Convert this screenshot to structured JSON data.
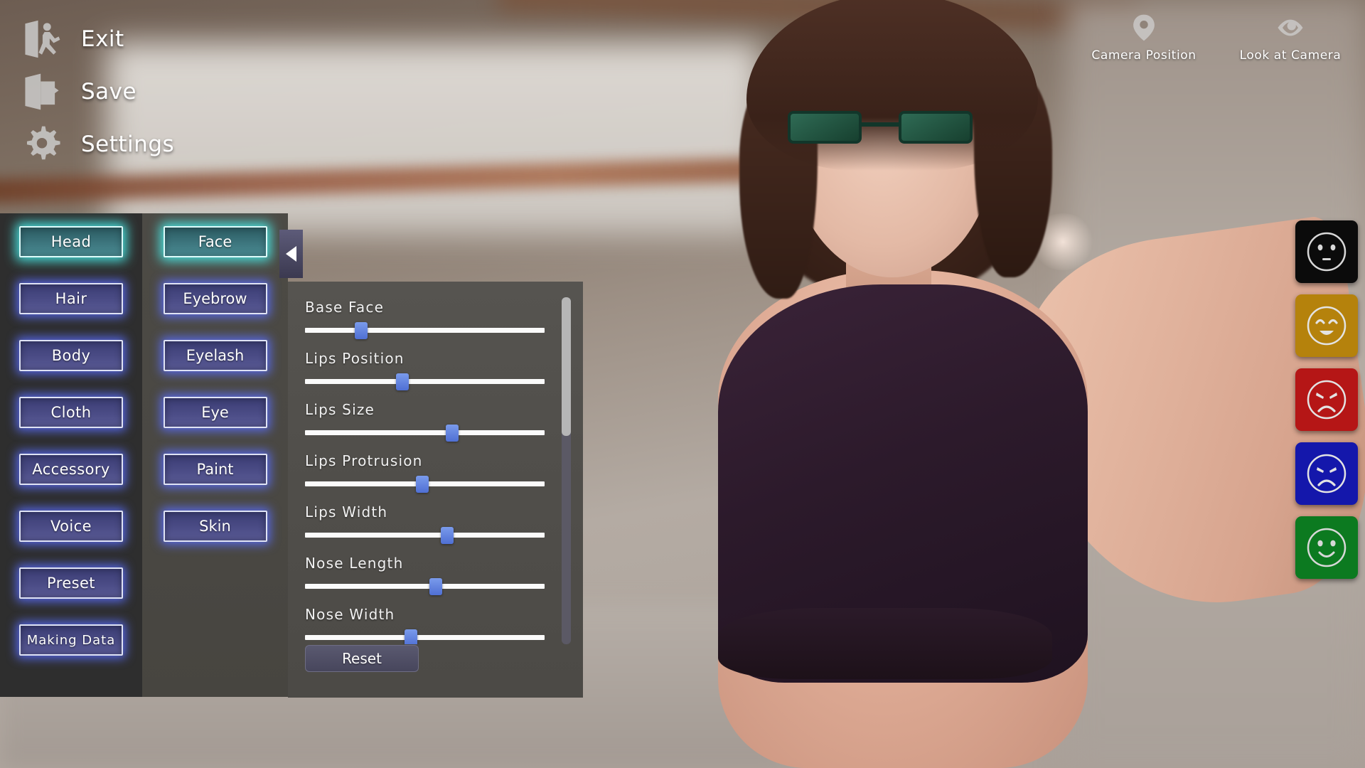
{
  "system_menu": {
    "items": [
      {
        "label": "Exit",
        "icon": "exit-door-icon"
      },
      {
        "label": "Save",
        "icon": "save-disk-icon"
      },
      {
        "label": "Settings",
        "icon": "gear-icon"
      }
    ]
  },
  "sidebar": {
    "selected": "Head",
    "items": [
      {
        "label": "Head",
        "active": true
      },
      {
        "label": "Hair",
        "active": false
      },
      {
        "label": "Body",
        "active": false
      },
      {
        "label": "Cloth",
        "active": false
      },
      {
        "label": "Accessory",
        "active": false
      },
      {
        "label": "Voice",
        "active": false
      },
      {
        "label": "Preset",
        "active": false
      },
      {
        "label": "Making Data",
        "active": false
      }
    ]
  },
  "subcategories": {
    "selected": "Face",
    "items": [
      {
        "label": "Face",
        "active": true
      },
      {
        "label": "Eyebrow",
        "active": false
      },
      {
        "label": "Eyelash",
        "active": false
      },
      {
        "label": "Eye",
        "active": false
      },
      {
        "label": "Paint",
        "active": false
      },
      {
        "label": "Skin",
        "active": false
      }
    ]
  },
  "slider_panel": {
    "collapse_tab_icon": "triangle-left-icon",
    "reset_label": "Reset",
    "scroll_thumb_percent": 40,
    "sliders": [
      {
        "label": "Base Face",
        "value": 22
      },
      {
        "label": "Lips Position",
        "value": 40
      },
      {
        "label": "Lips Size",
        "value": 62
      },
      {
        "label": "Lips Protrusion",
        "value": 49
      },
      {
        "label": "Lips Width",
        "value": 60
      },
      {
        "label": "Nose Length",
        "value": 55
      },
      {
        "label": "Nose Width",
        "value": 44
      }
    ]
  },
  "camera_controls": {
    "items": [
      {
        "label": "Camera Position",
        "icon": "map-pin-icon"
      },
      {
        "label": "Look at Camera",
        "icon": "eye-icon"
      }
    ]
  },
  "emotions": {
    "items": [
      {
        "name": "neutral",
        "color": "#0b0b0b"
      },
      {
        "name": "happy",
        "color": "#b5820c"
      },
      {
        "name": "angry",
        "color": "#b51616"
      },
      {
        "name": "sad",
        "color": "#1417ab"
      },
      {
        "name": "smile",
        "color": "#0c7a20"
      }
    ]
  },
  "colors": {
    "sidebar_bg": "#2e2e2e",
    "subpanel_bg": "#4a4843",
    "slider_panel_bg": "#514f4b",
    "button_blue": "#4b4c86",
    "button_glow_blue": "#5a6eff",
    "button_active_teal": "#3d767e",
    "button_glow_teal": "#4af0ec",
    "slider_track": "#fbfbfb",
    "slider_thumb": "#5f7fdd"
  }
}
